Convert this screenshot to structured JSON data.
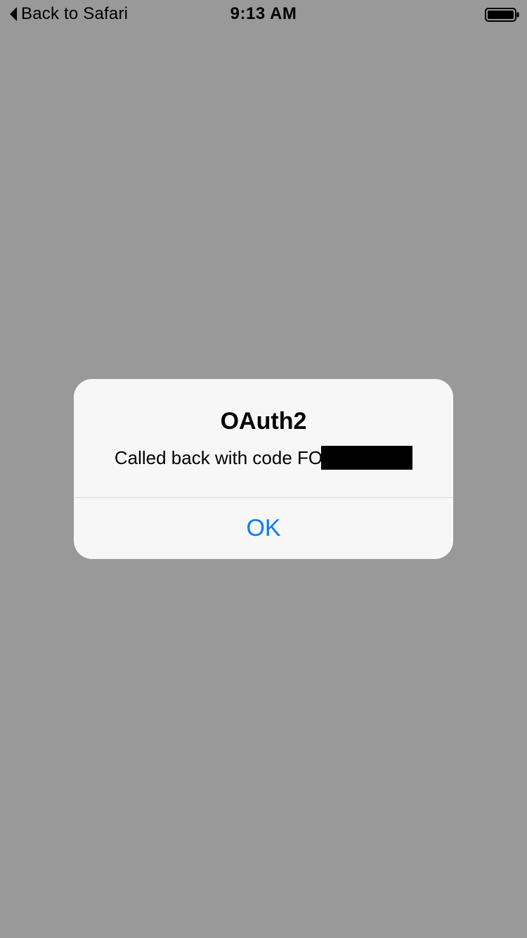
{
  "status_bar": {
    "back_label": "Back to Safari",
    "back_icon": "chevron-left-icon",
    "time": "9:13 AM",
    "battery_icon": "battery-icon"
  },
  "alert": {
    "title": "OAuth2",
    "message": "Called back with code FO",
    "message_redacted": true,
    "ok_label": "OK"
  },
  "colors": {
    "background": "#999999",
    "alert_background": "#f7f7f7",
    "accent": "#0a7cf5",
    "redaction": "#000000"
  }
}
